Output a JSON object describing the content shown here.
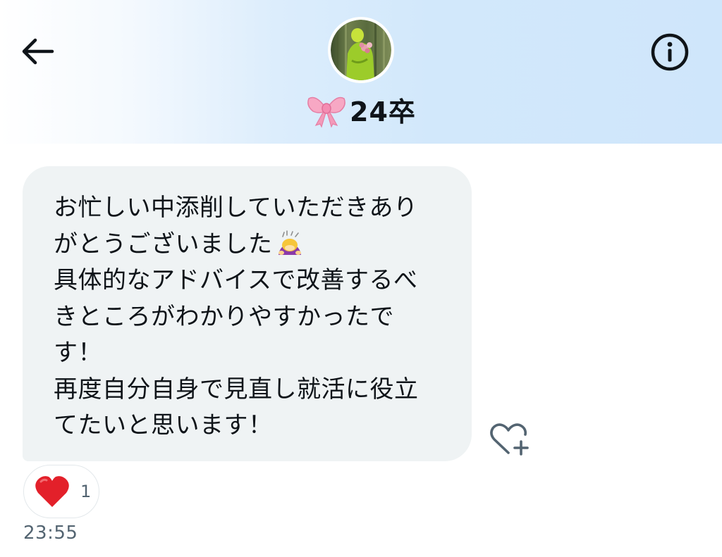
{
  "header": {
    "back_icon": "arrow-left-icon",
    "info_icon": "info-circle-icon",
    "avatar_icon": "user-avatar-image",
    "name_emoji": "ribbon-bow-emoji",
    "name": "24卒"
  },
  "message": {
    "lines": [
      "お忙しい中添削していただきあり",
      "がとうございました",
      "具体的なアドバイスで改善するべ",
      "きところがわかりやすかったで",
      "す！",
      "再度自分自身で見直し就活に役立",
      "てたいと思います！"
    ],
    "inline_emoji": "person-bowing-emoji",
    "add_reaction_icon": "heart-plus-icon"
  },
  "reaction": {
    "emoji": "red-heart-emoji",
    "count": "1"
  },
  "timestamp": "23:55",
  "colors": {
    "bubble_bg": "#eff3f4",
    "text": "#0f1419",
    "muted": "#536471",
    "header_gradient_end": "#cfe6fb"
  }
}
